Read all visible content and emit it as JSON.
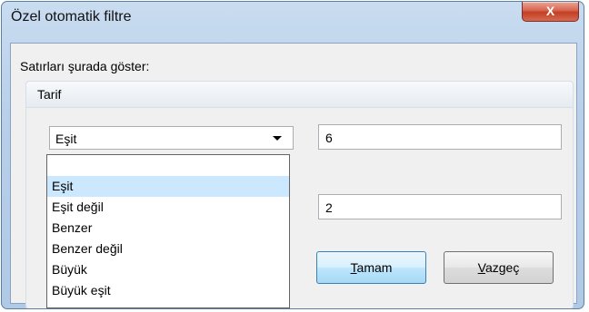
{
  "window": {
    "title": "Özel otomatik filtre",
    "close_glyph": "X"
  },
  "filter": {
    "show_rows_label": "Satırları şurada göster:",
    "group_title": "Tarif",
    "condition1": {
      "operator": "Eşit",
      "value": "6"
    },
    "condition2": {
      "value": "2"
    }
  },
  "dropdown": {
    "items": [
      "",
      "Eşit",
      "Eşit değil",
      "Benzer",
      "Benzer değil",
      "Büyük",
      "Büyük eşit"
    ],
    "selected_index": 1
  },
  "buttons": {
    "ok": {
      "accel": "T",
      "rest": "amam"
    },
    "cancel": {
      "accel": "V",
      "rest": "azgeç"
    }
  }
}
